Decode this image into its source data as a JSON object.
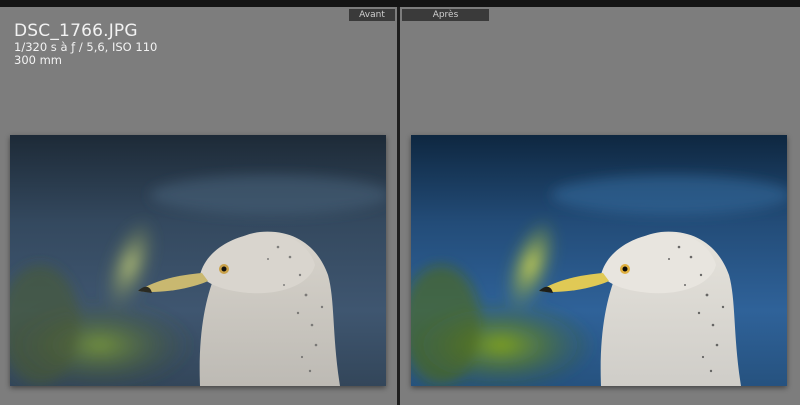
{
  "photo": {
    "filename": "DSC_1766.JPG",
    "exposure": "1/320 s à ƒ / 5,6, ISO 110",
    "focal_length": "300 mm"
  },
  "views": {
    "before_label": "Avant",
    "after_label": "Après"
  },
  "colors": {
    "before_bg_top": "#1f2e3e",
    "before_bg_mid": "#3e5670",
    "after_bg_top": "#0f2c4a",
    "after_bg_mid": "#2d5f92",
    "foliage_before": "#5a7a2c",
    "foliage_after": "#6f9a1a"
  }
}
